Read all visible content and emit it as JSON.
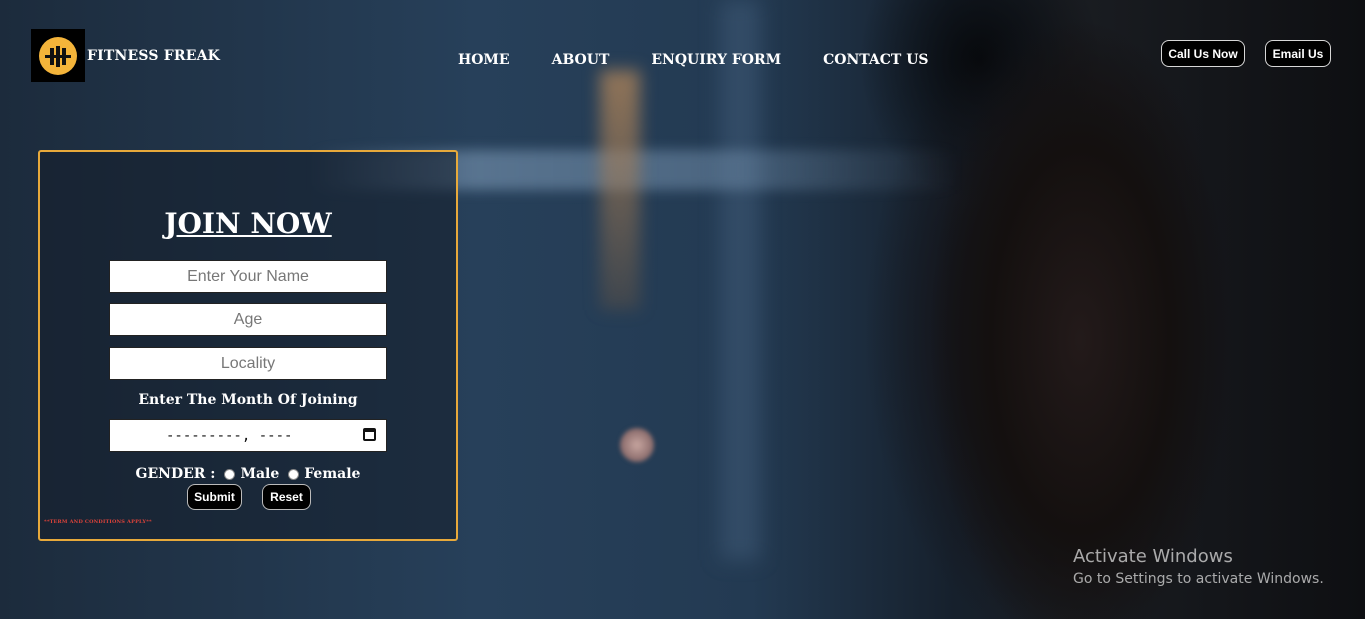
{
  "brand": {
    "title": "FITNESS FREAK",
    "logo_color": "#f4b43a"
  },
  "nav": {
    "items": [
      "HOME",
      "ABOUT",
      "ENQUIRY FORM",
      "CONTACT US"
    ]
  },
  "actions": {
    "call": "Call Us Now",
    "email": "Email Us"
  },
  "form": {
    "title": "JOIN NOW",
    "name_placeholder": "Enter Your Name",
    "age_placeholder": "Age",
    "locality_placeholder": "Locality",
    "month_label": "Enter The Month Of Joining",
    "date_value": "---------, ----",
    "gender_label": "GENDER :",
    "gender_options": [
      "Male",
      "Female"
    ],
    "submit": "Submit",
    "reset": "Reset",
    "terms": "**TERM AND CONDITIONS APPLY**",
    "border_color": "#e7a93b"
  },
  "os_overlay": {
    "line1": "Activate Windows",
    "line2": "Go to Settings to activate Windows."
  }
}
